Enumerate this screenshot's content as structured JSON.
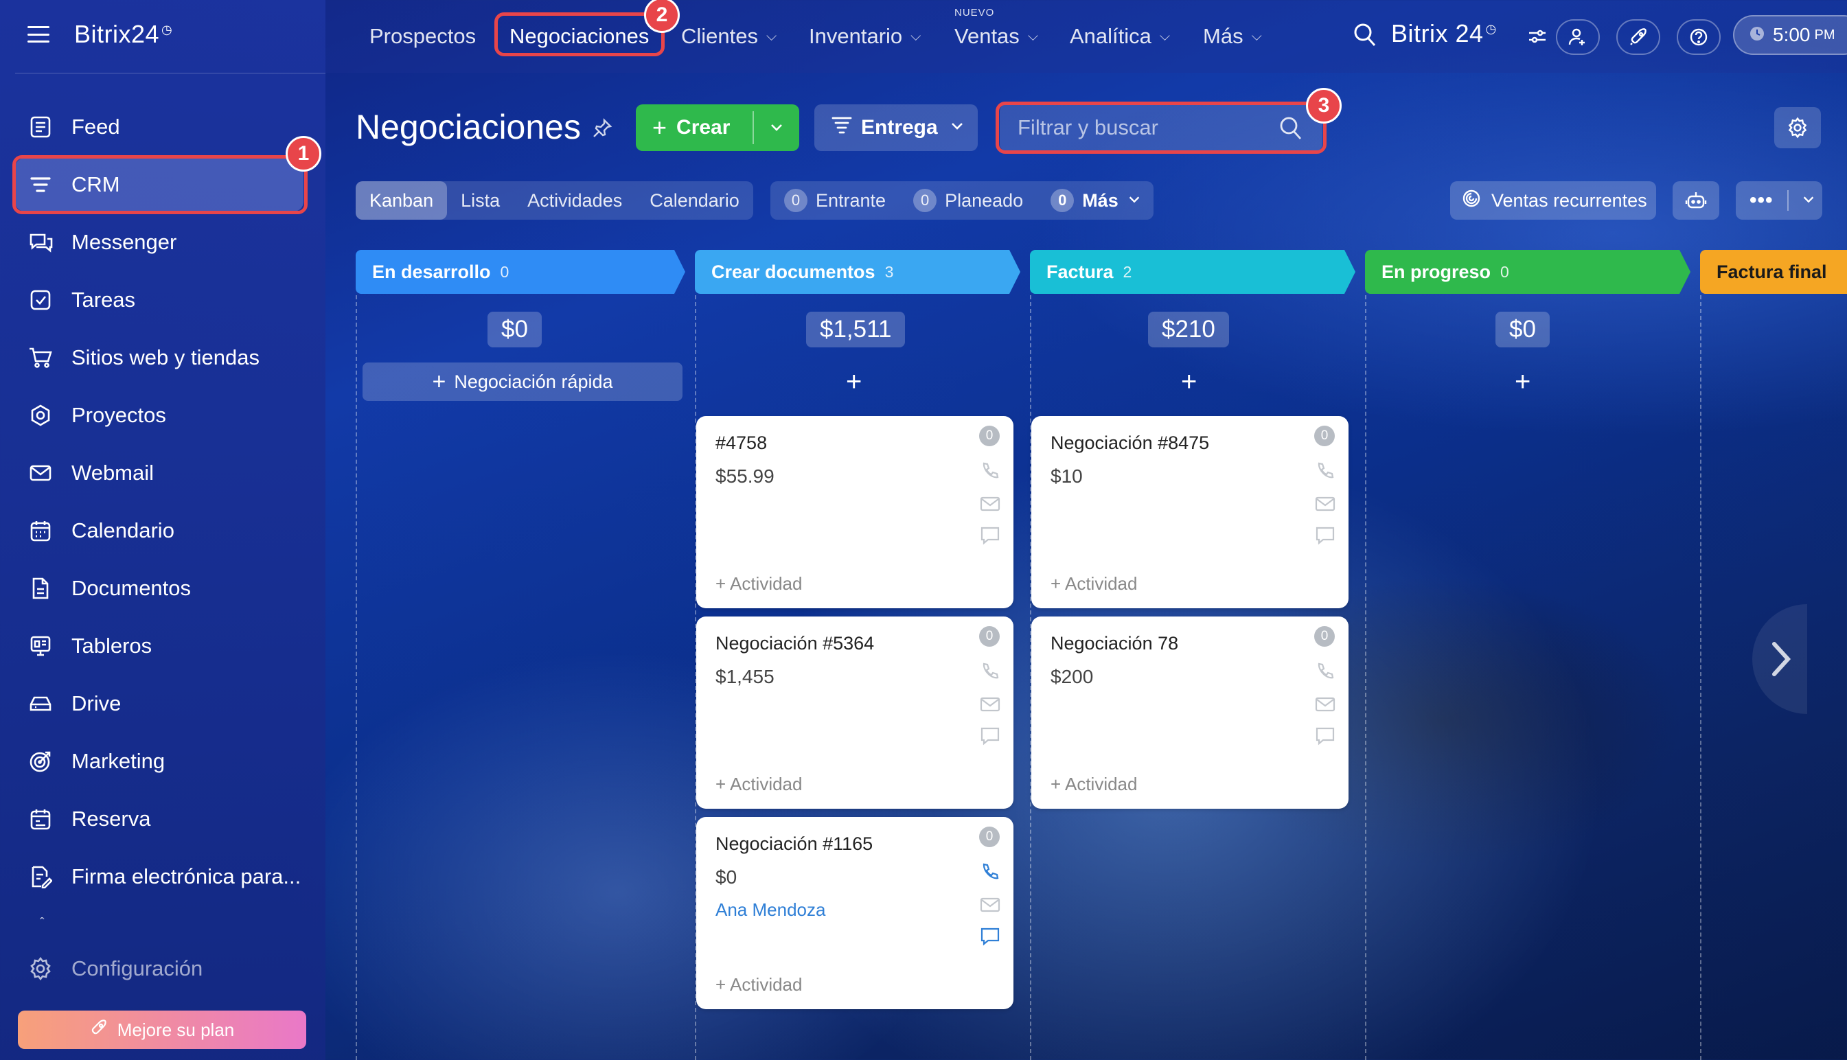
{
  "sidebar": {
    "logo": "Bitrix24",
    "items": [
      {
        "label": "Feed"
      },
      {
        "label": "CRM"
      },
      {
        "label": "Messenger"
      },
      {
        "label": "Tareas"
      },
      {
        "label": "Sitios web y tiendas"
      },
      {
        "label": "Proyectos"
      },
      {
        "label": "Webmail"
      },
      {
        "label": "Calendario"
      },
      {
        "label": "Documentos"
      },
      {
        "label": "Tableros"
      },
      {
        "label": "Drive"
      },
      {
        "label": "Marketing"
      },
      {
        "label": "Reserva"
      },
      {
        "label": "Firma electrónica para..."
      }
    ],
    "settings_label": "Configuración",
    "upgrade_label": "Mejore su plan"
  },
  "topnav": {
    "items": [
      "Prospectos",
      "Negociaciones",
      "Clientes",
      "Inventario",
      "Ventas",
      "Analítica",
      "Más"
    ],
    "new_badge": "NUEVO",
    "brand": "Bitrix 24",
    "time": "5:00",
    "time_suffix": "PM"
  },
  "annotations": [
    "1",
    "2",
    "3"
  ],
  "page": {
    "title": "Negociaciones",
    "create_label": "Crear",
    "pipeline_label": "Entrega",
    "search_placeholder": "Filtrar y buscar"
  },
  "views": [
    "Kanban",
    "Lista",
    "Actividades",
    "Calendario"
  ],
  "counters": [
    {
      "count": "0",
      "label": "Entrante"
    },
    {
      "count": "0",
      "label": "Planeado"
    },
    {
      "count": "0",
      "label": "Más"
    }
  ],
  "recurring_label": "Ventas recurrentes",
  "kanban": {
    "columns": [
      {
        "title": "En desarrollo",
        "count": "0",
        "sum": "$0",
        "color": "#2f8cf5"
      },
      {
        "title": "Crear documentos",
        "count": "3",
        "sum": "$1,511",
        "color": "#3aa7f2"
      },
      {
        "title": "Factura",
        "count": "2",
        "sum": "$210",
        "color": "#19bfd6"
      },
      {
        "title": "En progreso",
        "count": "0",
        "sum": "$0",
        "color": "#2fb94c"
      },
      {
        "title": "Factura final",
        "color": "#f5a623"
      }
    ],
    "quick_deal_label": "Negociación rápida",
    "cards": [
      {
        "title": "#4758",
        "amount": "$55.99",
        "activity": "+ Actividad",
        "counter": "0"
      },
      {
        "title": "Negociación #5364",
        "amount": "$1,455",
        "activity": "+ Actividad",
        "counter": "0"
      },
      {
        "title": "Negociación #1165",
        "amount": "$0",
        "client": "Ana Mendoza",
        "activity": "+ Actividad",
        "counter": "0"
      },
      {
        "title": "Negociación #8475",
        "amount": "$10",
        "activity": "+ Actividad",
        "counter": "0"
      },
      {
        "title": "Negociación 78",
        "amount": "$200",
        "activity": "+ Actividad",
        "counter": "0"
      }
    ]
  }
}
